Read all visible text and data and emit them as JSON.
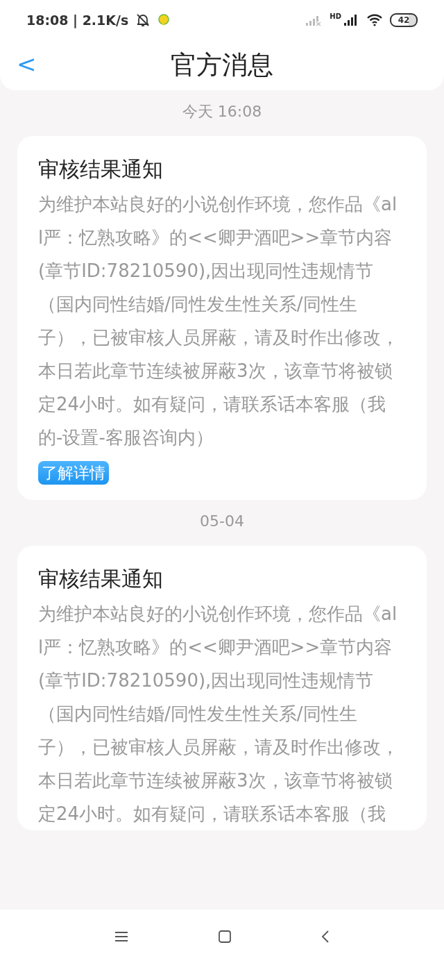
{
  "status_bar": {
    "time": "18:08 | 2.1K/s",
    "network": "HD",
    "battery": "42"
  },
  "header": {
    "back": "<",
    "title": "官方消息"
  },
  "messages": [
    {
      "date": "今天 16:08",
      "title": "审核结果通知",
      "body": "为维护本站良好的小说创作环境，您作品《all严：忆熟攻略》的<<卿尹酒吧>>章节内容(章节ID:78210590),因出现同性违规情节（国内同性结婚/同性发生性关系/同性生子），已被审核人员屏蔽，请及时作出修改，本日若此章节连续被屏蔽3次，该章节将被锁定24小时。如有疑问，请联系话本客服（我的-设置-客服咨询内）",
      "button": "了解详情"
    },
    {
      "date": "05-04",
      "title": "审核结果通知",
      "body": "为维护本站良好的小说创作环境，您作品《all严：忆熟攻略》的<<卿尹酒吧>>章节内容(章节ID:78210590),因出现同性违规情节（国内同性结婚/同性发生性关系/同性生子），已被审核人员屏蔽，请及时作出修改，本日若此章节连续被屏蔽3次，该章节将被锁定24小时。如有疑问，请联系话本客服（我"
    }
  ]
}
